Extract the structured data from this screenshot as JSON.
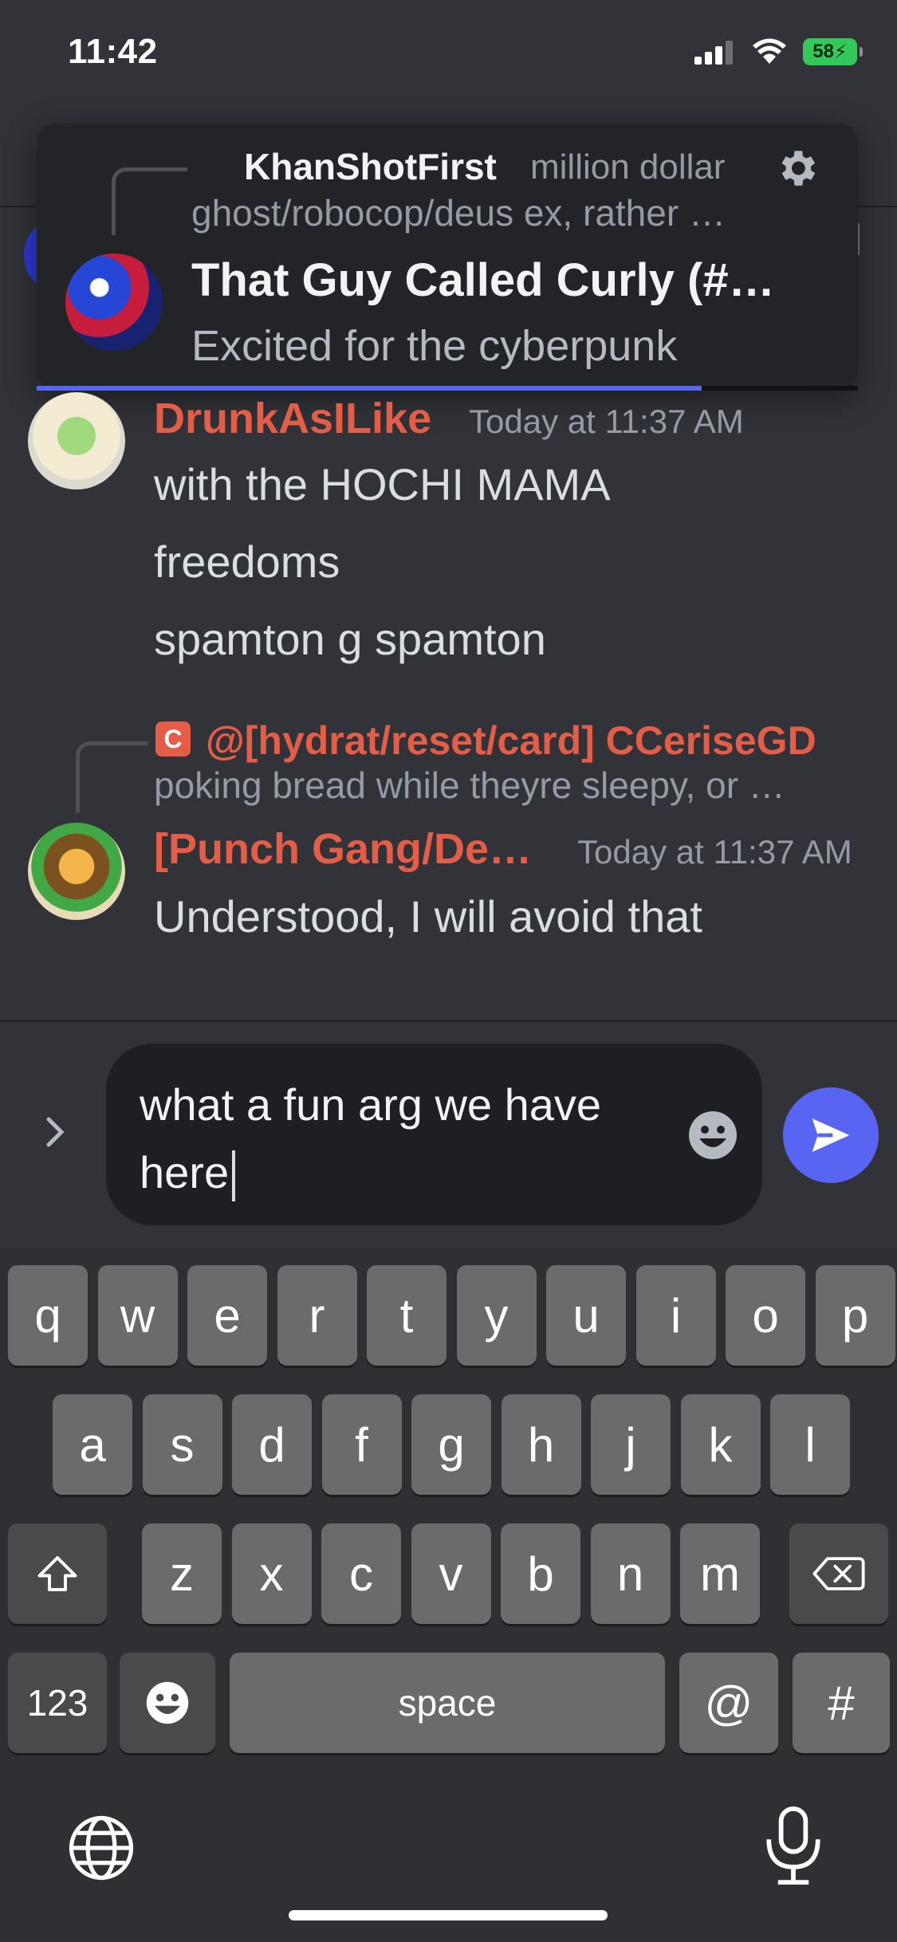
{
  "status_bar": {
    "time": "11:42",
    "battery": "58"
  },
  "notification": {
    "username": "KhanShotFirst",
    "preview_inline": "million dollar",
    "reply_text": "ghost/robocop/deus ex, rather …",
    "title": "That Guy Called Curly (#…",
    "body": "Excited for the cyberpunk",
    "progress_fraction": 0.81
  },
  "messages": [
    {
      "author": "DrunkAsILike",
      "timestamp": "Today at 11:37 AM",
      "lines": [
        "with the HOCHI MAMA",
        "freedoms",
        "spamton g spamton"
      ]
    },
    {
      "reply_to": {
        "icon": "C",
        "author": "@[hydrat/reset/card] CCeriseGD",
        "preview": "poking bread while theyre sleepy, or …"
      },
      "author": "[Punch Gang/De…",
      "timestamp": "Today at 11:37 AM",
      "lines": [
        "Understood, I will avoid that"
      ]
    }
  ],
  "composer": {
    "text": "what a fun arg we have here"
  },
  "keyboard": {
    "row1": [
      "q",
      "w",
      "e",
      "r",
      "t",
      "y",
      "u",
      "i",
      "o",
      "p"
    ],
    "row2": [
      "a",
      "s",
      "d",
      "f",
      "g",
      "h",
      "j",
      "k",
      "l"
    ],
    "row3": [
      "z",
      "x",
      "c",
      "v",
      "b",
      "n",
      "m"
    ],
    "numbers_label": "123",
    "space_label": "space",
    "at_label": "@",
    "hash_label": "#"
  },
  "icons": {
    "settings": "gear-icon",
    "send": "send-icon",
    "emoji": "emoji-icon",
    "expand": "chevron-right-icon",
    "shift": "shift-icon",
    "backspace": "backspace-icon",
    "globe": "globe-icon",
    "mic": "microphone-icon"
  },
  "colors": {
    "accent": "#5865f2",
    "username": "#e35d47",
    "background": "#313338"
  }
}
